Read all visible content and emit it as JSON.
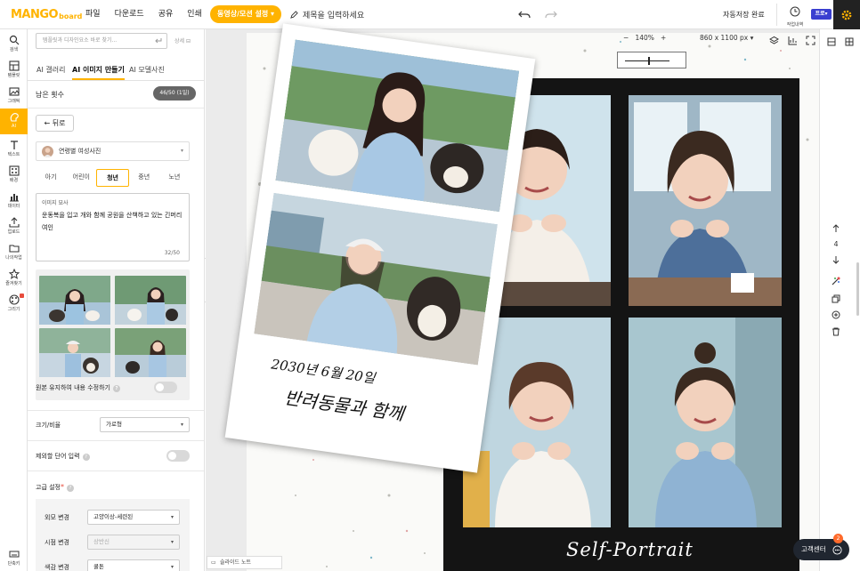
{
  "app": {
    "logo_main": "MANGO",
    "logo_sub": "board"
  },
  "menu": [
    "파일",
    "다운로드",
    "공유",
    "인쇄"
  ],
  "top": {
    "motion_pill": "동영상/모션 설정",
    "title_placeholder": "제목을 입력하세요",
    "autosave": "자동저장 완료",
    "history": "작업내역",
    "pro": "프로"
  },
  "left_nav": [
    {
      "label": "검색",
      "icon": "search-icon"
    },
    {
      "label": "템플릿",
      "icon": "template-icon"
    },
    {
      "label": "그래픽",
      "icon": "graphic-icon"
    },
    {
      "label": "AI",
      "icon": "ai-icon",
      "active": true
    },
    {
      "label": "텍스트",
      "icon": "text-icon"
    },
    {
      "label": "배경",
      "icon": "background-icon"
    },
    {
      "label": "데이터",
      "icon": "chart-icon"
    },
    {
      "label": "업로드",
      "icon": "upload-icon"
    },
    {
      "label": "나의작업",
      "icon": "folder-icon"
    },
    {
      "label": "즐겨찾기",
      "icon": "star-icon"
    },
    {
      "label": "그리기",
      "icon": "palette-icon"
    },
    {
      "label": "단축키",
      "icon": "keyboard-icon"
    }
  ],
  "panel": {
    "search_placeholder": "템플릿과 디자인요소 바로 찾기...",
    "advanced": "상세",
    "tabs": [
      "AI 갤러리",
      "AI 이미지 만들기",
      "AI 모델사진"
    ],
    "remain_label": "남은 횟수",
    "remain_value": "46/50 (1일)",
    "back": "뒤로",
    "model_select": "연령별 여성사진",
    "ages": [
      "아기",
      "어린이",
      "청년",
      "중년",
      "노년"
    ],
    "desc_label": "이미지 묘사",
    "desc_text": "운동복을 입고 개와 함께 공원을 산책하고 있는 긴머리 여인",
    "desc_count": "32/50",
    "keep_label": "원본 유지하여 내용 수정하기",
    "ratio_label": "크기/비율",
    "ratio_value": "가로형",
    "exclude_label": "제외할 단어 입력",
    "advanced_label": "고급 설정",
    "rows": [
      {
        "label": "외모 변경",
        "value": "고양이상-세련된"
      },
      {
        "label": "시점 변경",
        "value": "상반신"
      },
      {
        "label": "색감 변경",
        "value": "쿨톤"
      }
    ]
  },
  "toolbar": {
    "zoom": "140%",
    "size": "860 x 1100 px"
  },
  "canvas": {
    "caption_line1": "2030년 6월 20일",
    "caption_line2": "반려동물과 함께",
    "self_portrait": "Self-Portrait"
  },
  "right": {
    "page": "4"
  },
  "bottom": {
    "slide_note": "슬라이드 노트",
    "help": "고객센터",
    "help_badge": "2"
  }
}
